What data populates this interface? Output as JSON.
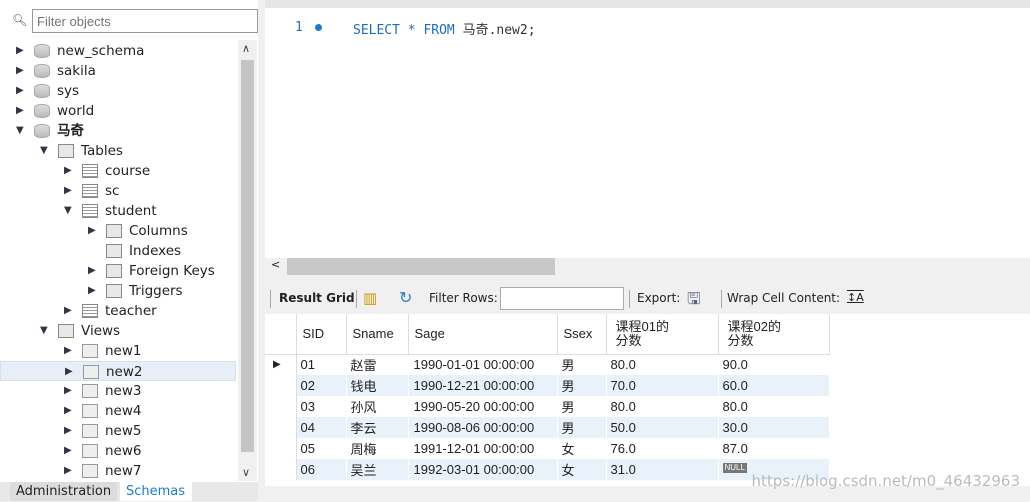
{
  "sidebar": {
    "filter_placeholder": "Filter objects",
    "tree": [
      {
        "label": "new_schema",
        "level": 0,
        "icon": "database-icon",
        "state": "collapsed"
      },
      {
        "label": "sakila",
        "level": 0,
        "icon": "database-icon",
        "state": "collapsed"
      },
      {
        "label": "sys",
        "level": 0,
        "icon": "database-icon",
        "state": "collapsed"
      },
      {
        "label": "world",
        "level": 0,
        "icon": "database-icon",
        "state": "collapsed"
      },
      {
        "label": "马奇",
        "level": 0,
        "icon": "database-icon",
        "state": "expanded",
        "bold": true
      },
      {
        "label": "Tables",
        "level": 1,
        "icon": "folder-icon",
        "state": "expanded"
      },
      {
        "label": "course",
        "level": 2,
        "icon": "table-icon",
        "state": "collapsed"
      },
      {
        "label": "sc",
        "level": 2,
        "icon": "table-icon",
        "state": "collapsed"
      },
      {
        "label": "student",
        "level": 2,
        "icon": "table-icon",
        "state": "expanded"
      },
      {
        "label": "Columns",
        "level": 3,
        "icon": "columns-icon",
        "state": "collapsed"
      },
      {
        "label": "Indexes",
        "level": 3,
        "icon": "folder-icon",
        "state": "none"
      },
      {
        "label": "Foreign Keys",
        "level": 3,
        "icon": "folder-icon",
        "state": "collapsed"
      },
      {
        "label": "Triggers",
        "level": 3,
        "icon": "folder-icon",
        "state": "collapsed"
      },
      {
        "label": "teacher",
        "level": 2,
        "icon": "table-icon",
        "state": "collapsed"
      },
      {
        "label": "Views",
        "level": 1,
        "icon": "folder-icon",
        "state": "expanded"
      },
      {
        "label": "new1",
        "level": 2,
        "icon": "view-icon",
        "state": "collapsed"
      },
      {
        "label": "new2",
        "level": 2,
        "icon": "view-icon",
        "state": "collapsed",
        "selected": true
      },
      {
        "label": "new3",
        "level": 2,
        "icon": "view-icon",
        "state": "collapsed"
      },
      {
        "label": "new4",
        "level": 2,
        "icon": "view-icon",
        "state": "collapsed"
      },
      {
        "label": "new5",
        "level": 2,
        "icon": "view-icon",
        "state": "collapsed"
      },
      {
        "label": "new6",
        "level": 2,
        "icon": "view-icon",
        "state": "collapsed"
      },
      {
        "label": "new7",
        "level": 2,
        "icon": "view-icon",
        "state": "collapsed"
      }
    ],
    "tabs": {
      "administration": "Administration",
      "schemas": "Schemas"
    }
  },
  "editor": {
    "line_number": "1",
    "sql_keywords": "SELECT * FROM",
    "sql_rest": "马奇.new2;"
  },
  "result_toolbar": {
    "result_grid": "Result Grid",
    "filter_rows": "Filter Rows:",
    "export": "Export:",
    "wrap": "Wrap Cell Content:"
  },
  "grid": {
    "columns": [
      "SID",
      "Sname",
      "Sage",
      "Ssex",
      "课程01的\n分数",
      "课程02的\n分数"
    ],
    "rows": [
      [
        "01",
        "赵雷",
        "1990-01-01 00:00:00",
        "男",
        "80.0",
        "90.0"
      ],
      [
        "02",
        "钱电",
        "1990-12-21 00:00:00",
        "男",
        "70.0",
        "60.0"
      ],
      [
        "03",
        "孙风",
        "1990-05-20 00:00:00",
        "男",
        "80.0",
        "80.0"
      ],
      [
        "04",
        "李云",
        "1990-08-06 00:00:00",
        "男",
        "50.0",
        "30.0"
      ],
      [
        "05",
        "周梅",
        "1991-12-01 00:00:00",
        "女",
        "76.0",
        "87.0"
      ],
      [
        "06",
        "吴兰",
        "1992-03-01 00:00:00",
        "女",
        "31.0",
        "NULL"
      ]
    ]
  },
  "watermark": "https://blog.csdn.net/m0_46432963",
  "colors": {
    "keyword": "#1a6cc0",
    "selected_row": "#e8eef8",
    "alt_row": "#e9f1fb",
    "active_tab": "#1a7bd6"
  }
}
